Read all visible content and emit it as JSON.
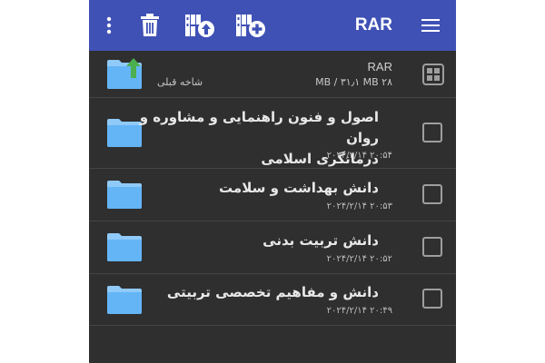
{
  "toolbar": {
    "title": "RAR",
    "icons": [
      "more-vert-icon",
      "delete-icon",
      "extract-archive-icon",
      "add-to-archive-icon",
      "hamburger-menu-icon"
    ],
    "color": "#3f51b5"
  },
  "parent_entry": {
    "archive_name": "RAR",
    "size": "۲۸ MB / ۳۱٫۱ MB",
    "label": "شاخه قبلی"
  },
  "items": [
    {
      "name_line1": "اصول و فنون راهنمایی و مشاوره و روان",
      "name_line2": "درمانگری اسلامی",
      "date": "۲۰:۵۴ ۲۰۲۴/۲/۱۴"
    },
    {
      "name_line1": "دانش بهداشت و سلامت",
      "date": "۲۰:۵۳ ۲۰۲۴/۲/۱۴"
    },
    {
      "name_line1": "دانش تربیت بدنی",
      "date": "۲۰:۵۲ ۲۰۲۴/۲/۱۴"
    },
    {
      "name_line1": "دانش و مفاهیم تخصصی تربیتی",
      "date": "۲۰:۴۹ ۲۰۲۴/۲/۱۴"
    }
  ]
}
